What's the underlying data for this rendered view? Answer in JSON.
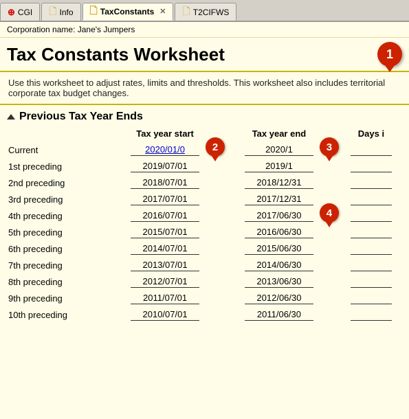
{
  "tabs": [
    {
      "id": "cgi",
      "label": "CGI",
      "icon": "cgi",
      "active": false,
      "closable": false
    },
    {
      "id": "info",
      "label": "Info",
      "icon": "doc",
      "active": false,
      "closable": false
    },
    {
      "id": "taxconstants",
      "label": "TaxConstants",
      "icon": "doc",
      "active": true,
      "closable": true
    },
    {
      "id": "t2cifws",
      "label": "T2CIFWS",
      "icon": "doc",
      "active": false,
      "closable": false
    }
  ],
  "corp_label": "Corporation name:",
  "corp_name": "Jane's Jumpers",
  "page_title": "Tax Constants Worksheet",
  "badge1": "1",
  "info_text": "Use this worksheet to adjust rates, limits and thresholds. This worksheet also includes territorial corporate tax budget changes.",
  "section_title": "Previous Tax Year Ends",
  "table": {
    "headers": [
      "Tax year start",
      "Tax year end",
      "Days i"
    ],
    "rows": [
      {
        "label": "Current",
        "start": "2020/01/0",
        "end": "2020/1",
        "days": "",
        "start_link": true,
        "badge_start": "2",
        "badge_end": "3"
      },
      {
        "label": "1st preceding",
        "start": "2019/07/01",
        "end": "2019/1",
        "days": "",
        "start_link": false
      },
      {
        "label": "2nd preceding",
        "start": "2018/07/01",
        "end": "2018/12/31",
        "days": "",
        "start_link": false
      },
      {
        "label": "3rd preceding",
        "start": "2017/07/01",
        "end": "2017/12/31",
        "days": "",
        "start_link": false
      },
      {
        "label": "4th preceding",
        "start": "2016/07/01",
        "end": "2017/06/30",
        "days": "",
        "start_link": false,
        "badge_end": "4"
      },
      {
        "label": "5th preceding",
        "start": "2015/07/01",
        "end": "2016/06/30",
        "days": "",
        "start_link": false
      },
      {
        "label": "6th preceding",
        "start": "2014/07/01",
        "end": "2015/06/30",
        "days": "",
        "start_link": false
      },
      {
        "label": "7th preceding",
        "start": "2013/07/01",
        "end": "2014/06/30",
        "days": "",
        "start_link": false
      },
      {
        "label": "8th preceding",
        "start": "2012/07/01",
        "end": "2013/06/30",
        "days": "",
        "start_link": false
      },
      {
        "label": "9th preceding",
        "start": "2011/07/01",
        "end": "2012/06/30",
        "days": "",
        "start_link": false
      },
      {
        "label": "10th preceding",
        "start": "2010/07/01",
        "end": "2011/06/30",
        "days": "",
        "start_link": false
      }
    ]
  }
}
